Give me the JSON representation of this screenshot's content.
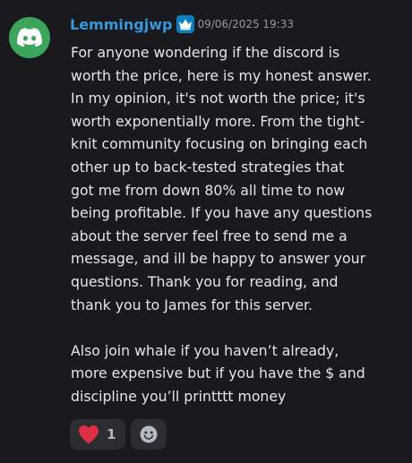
{
  "message": {
    "author": "Lemmingjwp",
    "timestamp": "09/06/2025 19:33",
    "author_color": "#3498db",
    "avatar_icon": "discord-logo-icon",
    "avatar_color": "#3ba55c",
    "badge_icon": "crown-icon",
    "lines": [
      "For anyone wondering if the discord is",
      "worth the price, here is my honest answer.",
      "In my opinion, it's not worth the price; it's",
      "worth exponentially more. From the tight-",
      "knit community focusing on bringing each",
      "other up to back-tested strategies that",
      "got me from down 80% all time to now",
      "being profitable. If you have any questions",
      "about the server feel free to send me a",
      "message, and ill be happy to answer your",
      "questions. Thank you for reading, and",
      "thank you to James for this server.",
      "",
      "Also join whale if you haven’t already,",
      "more expensive but if you have the $ and",
      "discipline you’ll printttt money"
    ],
    "reactions": [
      {
        "icon": "heart-icon",
        "count": "1"
      }
    ],
    "add_reaction_icon": "add-reaction-icon"
  }
}
